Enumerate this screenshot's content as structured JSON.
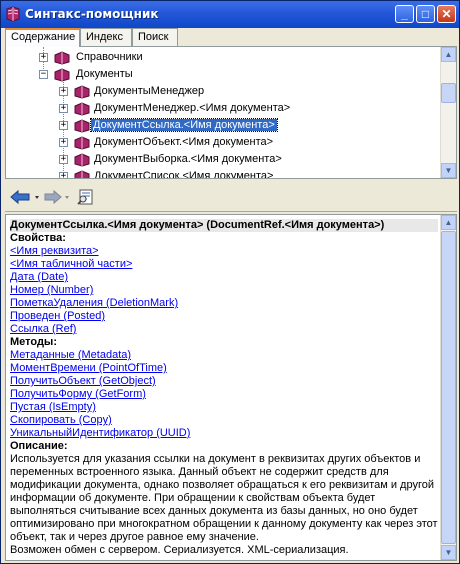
{
  "window": {
    "title": "Синтакс-помощник",
    "controls": {
      "minimize": "_",
      "maximize": "□",
      "close": "✕"
    }
  },
  "tabs": [
    {
      "label": "Содержание",
      "active": true
    },
    {
      "label": "Индекс",
      "active": false
    },
    {
      "label": "Поиск",
      "active": false
    }
  ],
  "tree": {
    "nodes": [
      {
        "label": "Справочники",
        "expander": "+"
      },
      {
        "label": "Документы",
        "expander": "−"
      },
      {
        "label": "ДокументыМенеджер",
        "expander": "+"
      },
      {
        "label": "ДокументМенеджер.<Имя документа>",
        "expander": "+"
      },
      {
        "label": "ДокументСсылка.<Имя документа>",
        "expander": "+",
        "selected": true
      },
      {
        "label": "ДокументОбъект.<Имя документа>",
        "expander": "+"
      },
      {
        "label": "ДокументВыборка.<Имя документа>",
        "expander": "+"
      },
      {
        "label": "ДокументСписок.<Имя документа>",
        "expander": "+"
      }
    ]
  },
  "toolbar": {
    "back_icon": "back-arrow-icon",
    "forward_icon": "forward-arrow-icon",
    "find_icon": "find-in-tree-icon"
  },
  "content": {
    "title": "ДокументСсылка.<Имя документа> (DocumentRef.<Имя документа>)",
    "properties_header": "Свойства:",
    "properties": [
      "<Имя реквизита>",
      "<Имя табличной части>",
      "Дата (Date)",
      "Номер (Number)",
      "ПометкаУдаления (DeletionMark)",
      "Проведен (Posted)",
      "Ссылка (Ref)"
    ],
    "methods_header": "Методы:",
    "methods": [
      "Метаданные (Metadata)",
      "МоментВремени (PointOfTime)",
      "ПолучитьОбъект (GetObject)",
      "ПолучитьФорму (GetForm)",
      "Пустая (IsEmpty)",
      "Скопировать (Copy)",
      "УникальныйИдентификатор (UUID)"
    ],
    "description_header": "Описание:",
    "description": "Используется для указания ссылки на документ в реквизитах других объектов и переменных встроенного языка. Данный объект не содержит средств для модификации документа, однако позволяет обращаться к его реквизитам и другой информации об документе. При обращении к свойствам объекта будет выполняться считывание всех данных документа из базы данных, но оно будет оптимизировано при многократном обращении к данному документу как через этот объект, так и через другое равное ему значение.",
    "note": "Возможен обмен с сервером. Сериализуется. XML-сериализация."
  }
}
